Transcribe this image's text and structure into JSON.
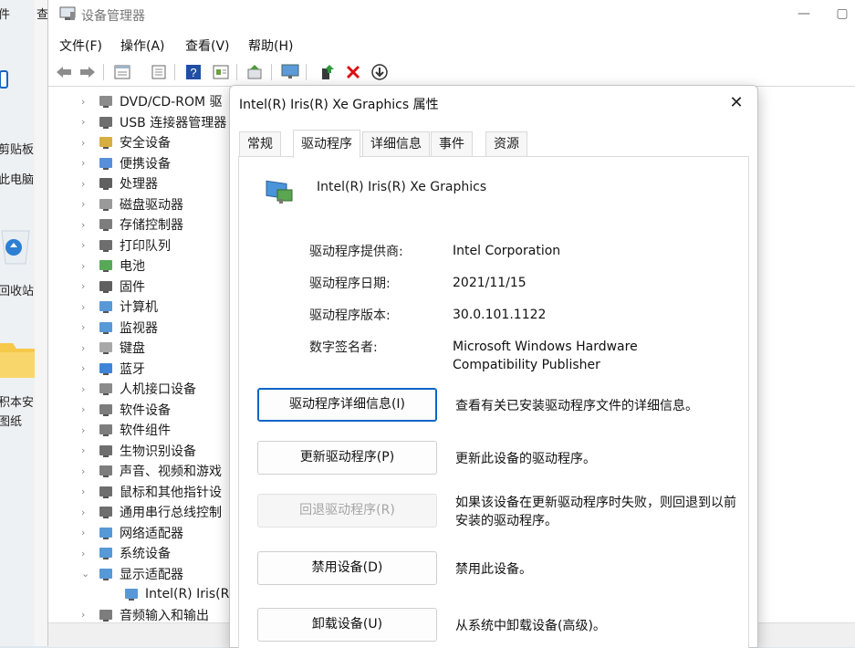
{
  "desktop": {
    "top_left_char": "件",
    "top_right_char": "查",
    "clipboard": "剪贴板",
    "this_pc": "此电脑",
    "recycle_bin": "回收站",
    "item_a": "积本安",
    "item_b": "图纸"
  },
  "device_manager": {
    "title": "设备管理器",
    "menu": [
      "文件(F)",
      "操作(A)",
      "查看(V)",
      "帮助(H)"
    ],
    "tree": [
      {
        "label": "DVD/CD-ROM 驱",
        "icon": "dvd-drive-icon",
        "expanded": false
      },
      {
        "label": "USB 连接器管理器",
        "icon": "usb-icon",
        "expanded": false
      },
      {
        "label": "安全设备",
        "icon": "key-icon",
        "expanded": false
      },
      {
        "label": "便携设备",
        "icon": "portable-device-icon",
        "expanded": false
      },
      {
        "label": "处理器",
        "icon": "processor-icon",
        "expanded": false
      },
      {
        "label": "磁盘驱动器",
        "icon": "disk-drive-icon",
        "expanded": false
      },
      {
        "label": "存储控制器",
        "icon": "storage-controller-icon",
        "expanded": false
      },
      {
        "label": "打印队列",
        "icon": "printer-icon",
        "expanded": false
      },
      {
        "label": "电池",
        "icon": "battery-icon",
        "expanded": false
      },
      {
        "label": "固件",
        "icon": "firmware-icon",
        "expanded": false
      },
      {
        "label": "计算机",
        "icon": "computer-icon",
        "expanded": false
      },
      {
        "label": "监视器",
        "icon": "monitor-icon",
        "expanded": false
      },
      {
        "label": "键盘",
        "icon": "keyboard-icon",
        "expanded": false
      },
      {
        "label": "蓝牙",
        "icon": "bluetooth-icon",
        "expanded": false
      },
      {
        "label": "人机接口设备",
        "icon": "hid-icon",
        "expanded": false
      },
      {
        "label": "软件设备",
        "icon": "software-device-icon",
        "expanded": false
      },
      {
        "label": "软件组件",
        "icon": "software-component-icon",
        "expanded": false
      },
      {
        "label": "生物识别设备",
        "icon": "fingerprint-icon",
        "expanded": false
      },
      {
        "label": "声音、视频和游戏",
        "icon": "speaker-icon",
        "expanded": false
      },
      {
        "label": "鼠标和其他指针设",
        "icon": "mouse-icon",
        "expanded": false
      },
      {
        "label": "通用串行总线控制",
        "icon": "usb-controller-icon",
        "expanded": false
      },
      {
        "label": "网络适配器",
        "icon": "network-adapter-icon",
        "expanded": false
      },
      {
        "label": "系统设备",
        "icon": "system-device-icon",
        "expanded": false
      },
      {
        "label": "显示适配器",
        "icon": "display-adapter-icon",
        "expanded": true
      },
      {
        "label": "Intel(R) Iris(R)",
        "icon": "display-adapter-icon",
        "child": true
      },
      {
        "label": "音频输入和输出",
        "icon": "audio-icon",
        "expanded": false
      }
    ]
  },
  "dialog": {
    "title": "Intel(R) Iris(R) Xe Graphics 属性",
    "tabs": [
      "常规",
      "驱动程序",
      "详细信息",
      "事件",
      "资源"
    ],
    "active_tab": "驱动程序",
    "device_name": "Intel(R) Iris(R) Xe Graphics",
    "fields": [
      {
        "label": "驱动程序提供商:",
        "value": "Intel Corporation"
      },
      {
        "label": "驱动程序日期:",
        "value": "2021/11/15"
      },
      {
        "label": "驱动程序版本:",
        "value": "30.0.101.1122"
      },
      {
        "label": "数字签名者:",
        "value": "Microsoft Windows Hardware Compatibility Publisher"
      }
    ],
    "actions": [
      {
        "button": "驱动程序详细信息(I)",
        "desc": "查看有关已安装驱动程序文件的详细信息。",
        "state": "focused"
      },
      {
        "button": "更新驱动程序(P)",
        "desc": "更新此设备的驱动程序。",
        "state": "normal"
      },
      {
        "button": "回退驱动程序(R)",
        "desc": "如果该设备在更新驱动程序时失败，则回退到以前安装的驱动程序。",
        "state": "disabled"
      },
      {
        "button": "禁用设备(D)",
        "desc": "禁用此设备。",
        "state": "normal"
      },
      {
        "button": "卸载设备(U)",
        "desc": "从系统中卸载设备(高级)。",
        "state": "normal"
      }
    ]
  },
  "colors": {
    "accent": "#0a64c8",
    "disabled_text": "#a5a5a5"
  }
}
